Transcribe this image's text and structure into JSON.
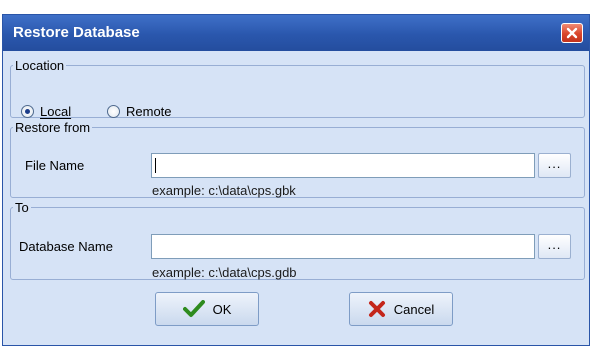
{
  "window": {
    "title": "Restore Database"
  },
  "location": {
    "legend": "Location",
    "options": [
      {
        "label": "Local",
        "selected": true
      },
      {
        "label": "Remote",
        "selected": false
      }
    ]
  },
  "restore_from": {
    "legend": "Restore from",
    "field_label": "File Name",
    "value": "",
    "browse_label": "...",
    "example": "example: c:\\data\\cps.gbk"
  },
  "to": {
    "legend": "To",
    "field_label": "Database Name",
    "value": "",
    "browse_label": "...",
    "example": "example: c:\\data\\cps.gdb"
  },
  "buttons": {
    "ok": "OK",
    "cancel": "Cancel"
  },
  "icons": {
    "close": "close-icon",
    "ok": "checkmark-icon",
    "cancel": "x-icon"
  },
  "colors": {
    "titlebar": "#2a57ad",
    "client": "#d6e3f6",
    "ok_check": "#2e8b1e",
    "cancel_x": "#c4261b"
  }
}
